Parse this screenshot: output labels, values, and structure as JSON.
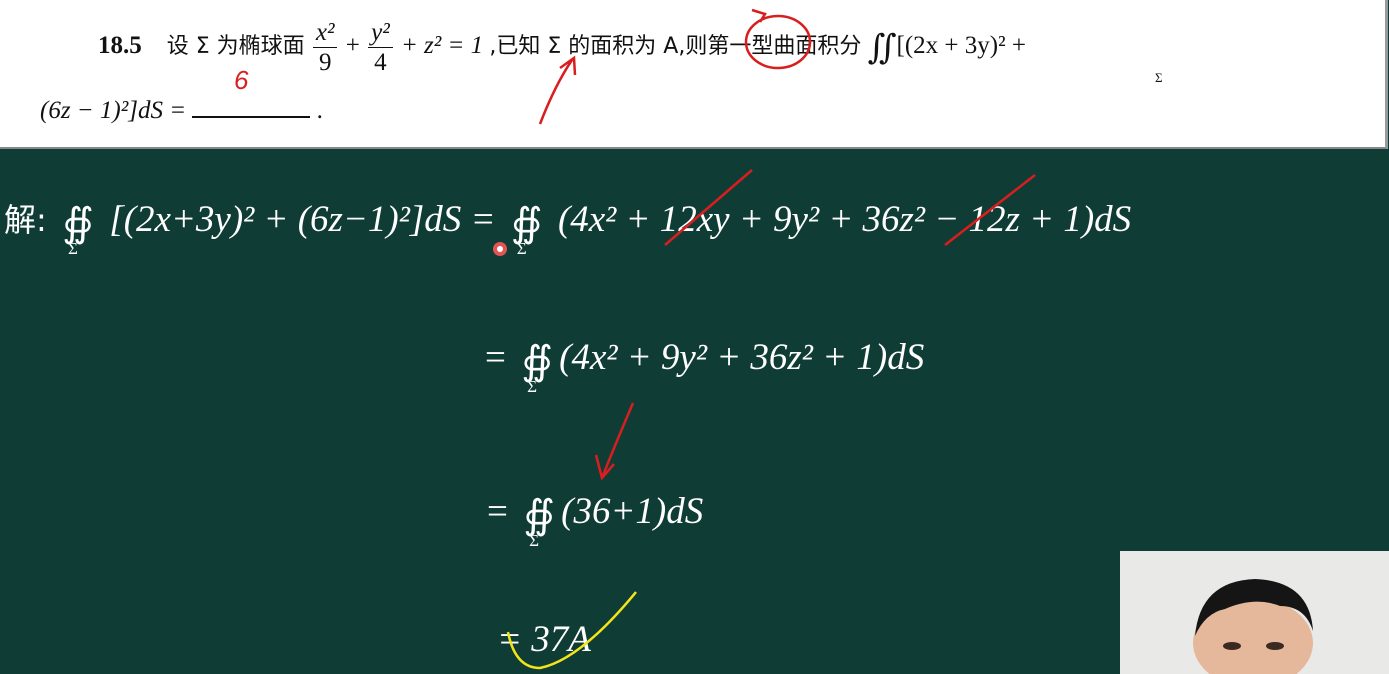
{
  "problem": {
    "number": "18.5",
    "text_a": "设 Σ 为椭球面",
    "frac1_num": "x²",
    "frac1_den": "9",
    "plus1": "+",
    "frac2_num": "y²",
    "frac2_den": "4",
    "rest_eq": "+ z² = 1",
    "text_b": ",已知 Σ 的面积为 A,则第一型曲面积分",
    "integral_tail": "[(2x + 3y)² +",
    "sub_sigma": "Σ",
    "line2_expr": "(6z − 1)²]dS =",
    "line2_end": "."
  },
  "solution": {
    "label": "解:",
    "line1_lhs": "[(2x+3y)² + (6z−1)²]dS =",
    "line1_rhs": "(4x² + 12xy + 9y² + 36z² − 12z + 1)dS",
    "line2": "= ",
    "line2_expr": "(4x² + 9y² + 36z² + 1)dS",
    "line3": "= ",
    "line3_expr": "(36+1)dS",
    "line4": "= 37A",
    "sigma": "Σ",
    "annotation_6": "6"
  },
  "colors": {
    "board": "#0f3d35",
    "ink_red": "#d81e1e",
    "ink_yellow": "#f2e51a"
  }
}
